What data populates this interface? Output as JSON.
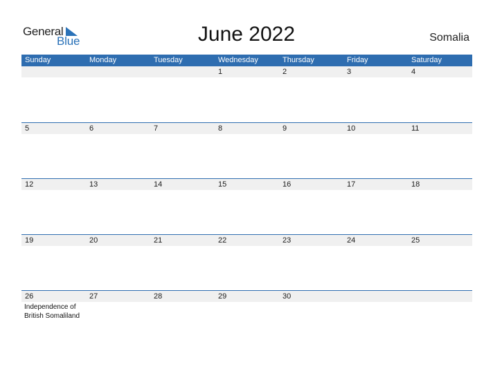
{
  "logo": {
    "line1": "General",
    "line2": "Blue"
  },
  "title": "June 2022",
  "country": "Somalia",
  "weekdays": [
    "Sunday",
    "Monday",
    "Tuesday",
    "Wednesday",
    "Thursday",
    "Friday",
    "Saturday"
  ],
  "weeks": [
    {
      "days": [
        "",
        "",
        "",
        "1",
        "2",
        "3",
        "4"
      ],
      "events": [
        "",
        "",
        "",
        "",
        "",
        "",
        ""
      ]
    },
    {
      "days": [
        "5",
        "6",
        "7",
        "8",
        "9",
        "10",
        "11"
      ],
      "events": [
        "",
        "",
        "",
        "",
        "",
        "",
        ""
      ]
    },
    {
      "days": [
        "12",
        "13",
        "14",
        "15",
        "16",
        "17",
        "18"
      ],
      "events": [
        "",
        "",
        "",
        "",
        "",
        "",
        ""
      ]
    },
    {
      "days": [
        "19",
        "20",
        "21",
        "22",
        "23",
        "24",
        "25"
      ],
      "events": [
        "",
        "",
        "",
        "",
        "",
        "",
        ""
      ]
    },
    {
      "days": [
        "26",
        "27",
        "28",
        "29",
        "30",
        "",
        ""
      ],
      "events": [
        "Independence of British Somaliland",
        "",
        "",
        "",
        "",
        "",
        ""
      ]
    }
  ],
  "colors": {
    "accent": "#2e6db0",
    "day_bar": "#f0f0f0",
    "logo_blue": "#2a72b8"
  }
}
